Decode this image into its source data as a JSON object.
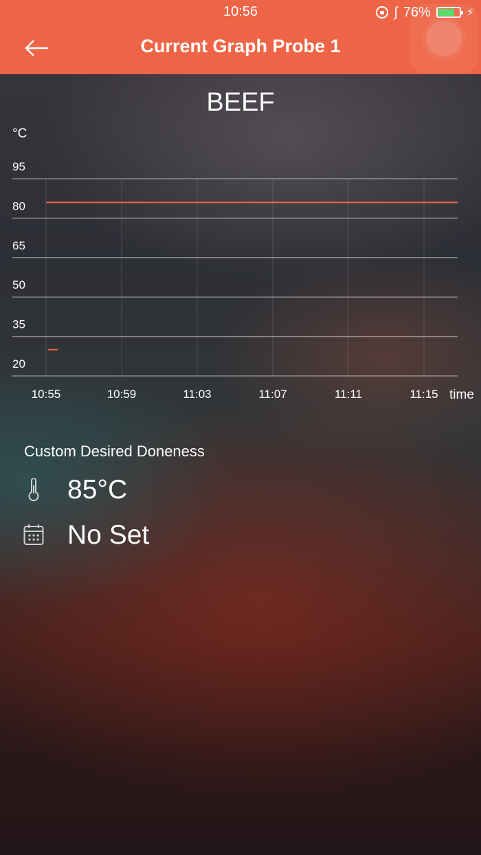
{
  "status_bar": {
    "time": "10:56",
    "battery": "76%",
    "battery_level": 0.76,
    "icons": [
      "orientation-lock-icon",
      "bluetooth-icon",
      "battery-icon",
      "charging-icon"
    ]
  },
  "header": {
    "title": "Current Graph Probe 1",
    "back_icon": "arrow-left-icon",
    "background": "#ee6446"
  },
  "chart_data": {
    "type": "line",
    "title": "BEEF",
    "ylabel": "°C",
    "xlabel": "time",
    "y_ticks": [
      "20",
      "35",
      "50",
      "65",
      "80",
      "95"
    ],
    "x_ticks": [
      "10:55",
      "10:59",
      "11:03",
      "11:07",
      "11:11",
      "11:15"
    ],
    "ylim": [
      20,
      95
    ],
    "grid": true,
    "series": [
      {
        "color": "#ee6446",
        "points": [
          {
            "x": "10:55",
            "y": 86
          },
          {
            "x": "11:15",
            "y": 86
          },
          {
            "x": "11:17",
            "y": 86
          }
        ]
      },
      {
        "color": "#ee6446",
        "points": [
          {
            "x": "10:55",
            "y": 30
          },
          {
            "x": "10:55",
            "y": 30
          }
        ]
      }
    ]
  },
  "doneness": {
    "label": "Custom Desired Doneness",
    "temperature": "85°C",
    "temperature_icon": "thermometer-icon",
    "timer": "No Set",
    "timer_icon": "calendar-icon"
  }
}
